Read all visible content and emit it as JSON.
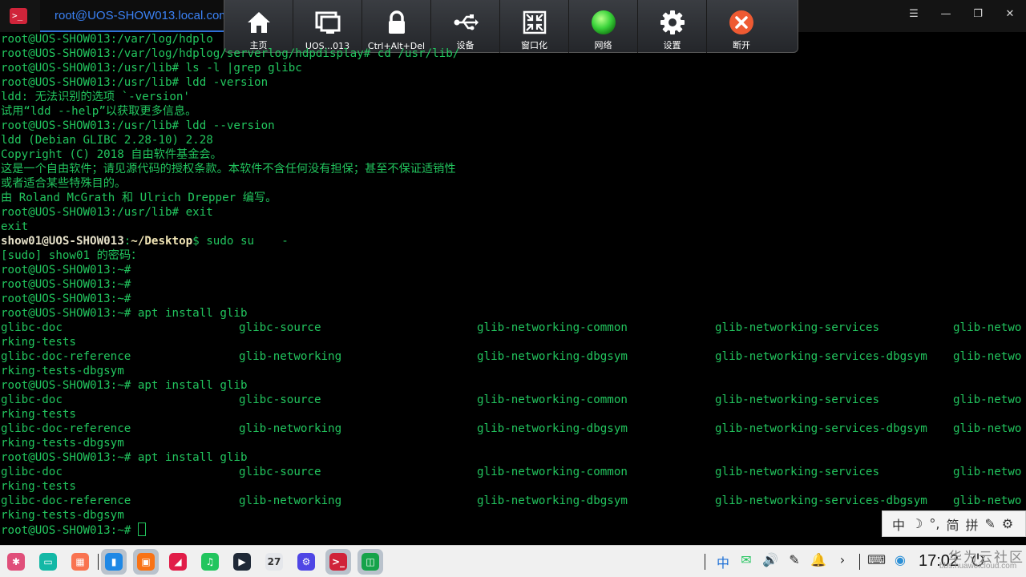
{
  "window": {
    "tab_title": "root@UOS-SHOW013.local.com",
    "term_glyph": ">_",
    "controls": {
      "menu": "☰",
      "minimize": "—",
      "restore": "❐",
      "close": "✕"
    }
  },
  "remote_toolbar": {
    "buttons": [
      {
        "label": "主页",
        "icon": "home-icon"
      },
      {
        "label": "UOS...013",
        "icon": "monitor-icon"
      },
      {
        "label": "Ctrl+Alt+Del",
        "icon": "lock-icon"
      },
      {
        "label": "设备",
        "icon": "usb-icon"
      },
      {
        "label": "窗口化",
        "icon": "windowed-icon"
      },
      {
        "label": "网络",
        "icon": "network-status-icon",
        "color": "#3bd43b"
      },
      {
        "label": "设置",
        "icon": "gear-icon"
      },
      {
        "label": "断开",
        "icon": "disconnect-icon",
        "color": "#ee5a32"
      }
    ]
  },
  "terminal": {
    "lines": [
      "root@UOS-SHOW013:/var/log/hdplo",
      "root@UOS-SHOW013:/var/log/hdplog/serverlog/hdpdisplay# cd /usr/lib/",
      "root@UOS-SHOW013:/usr/lib# ls -l |grep glibc",
      "root@UOS-SHOW013:/usr/lib# ldd -version",
      "ldd: 无法识别的选项 `-version'",
      "试用“ldd --help”以获取更多信息。",
      "root@UOS-SHOW013:/usr/lib# ldd --version",
      "ldd (Debian GLIBC 2.28-10) 2.28",
      "Copyright (C) 2018 自由软件基金会。",
      "这是一个自由软件；请见源代码的授权条款。本软件不含任何没有担保；甚至不保证适销性",
      "或者适合某些特殊目的。",
      "由 Roland McGrath 和 Ulrich Drepper 编写。",
      "root@UOS-SHOW013:/usr/lib# exit",
      "exit"
    ],
    "sudo_line": {
      "user": "show01@UOS-SHOW013",
      "colon": ":",
      "path": "~/Desktop",
      "rest": "$ sudo su    -"
    },
    "password_prompt": "[sudo] show01 的密码：",
    "empty_prompts": [
      "root@UOS-SHOW013:~#",
      "root@UOS-SHOW013:~#",
      "root@UOS-SHOW013:~#"
    ],
    "completion_blocks": [
      {
        "command": "root@UOS-SHOW013:~# apt install glib"
      },
      {
        "command": "root@UOS-SHOW013:~# apt install glib"
      },
      {
        "command": "root@UOS-SHOW013:~# apt install glib"
      }
    ],
    "completion_rows": [
      [
        "glibc-doc",
        "glibc-source",
        "glib-networking-common",
        "glib-networking-services",
        "glib-netwo"
      ],
      [
        "rking-tests"
      ],
      [
        "glibc-doc-reference",
        "glib-networking",
        "glib-networking-dbgsym",
        "glib-networking-services-dbgsym",
        "glib-netwo"
      ],
      [
        "rking-tests-dbgsym"
      ]
    ],
    "final_prompt": "root@UOS-SHOW013:~# "
  },
  "ime_bar": {
    "items": [
      "中",
      "☽",
      "°,",
      "简",
      "拼",
      "✎",
      "⚙"
    ]
  },
  "taskbar": {
    "apps": [
      {
        "name": "launcher-icon",
        "glyph": "✱",
        "color": "#e04f7a"
      },
      {
        "name": "multitask-icon",
        "glyph": "▭",
        "color": "#14b8a6"
      },
      {
        "name": "app-store-grid-icon",
        "glyph": "▦",
        "color": "#f97350"
      },
      {
        "name": "file-manager-icon",
        "glyph": "▮",
        "color": "#1e88e5",
        "active": true
      },
      {
        "name": "app-store-icon",
        "glyph": "▣",
        "color": "#f97316",
        "active": true
      },
      {
        "name": "photos-icon",
        "glyph": "◢",
        "color": "#e11d48"
      },
      {
        "name": "music-icon",
        "glyph": "♫",
        "color": "#22c55e"
      },
      {
        "name": "video-icon",
        "glyph": "▶",
        "color": "#1f2937"
      },
      {
        "name": "calendar-icon",
        "glyph": "27",
        "color": "#e5e7eb",
        "fg": "#333"
      },
      {
        "name": "settings-app-icon",
        "glyph": "⚙",
        "color": "#4f46e5"
      },
      {
        "name": "terminal-app-icon",
        "glyph": ">_",
        "color": "#d0243a",
        "active": true
      },
      {
        "name": "remote-app-icon",
        "glyph": "◫",
        "color": "#16a34a",
        "active": true
      }
    ],
    "tray": [
      {
        "name": "input-method-tray-icon",
        "glyph": "中",
        "color": "#1d6fd6"
      },
      {
        "name": "wechat-tray-icon",
        "glyph": "✉",
        "color": "#22c55e"
      },
      {
        "name": "volume-icon",
        "glyph": "🔊",
        "color": "#222"
      },
      {
        "name": "pen-tray-icon",
        "glyph": "✎",
        "color": "#222"
      },
      {
        "name": "notification-bell-icon",
        "glyph": "🔔",
        "color": "#222"
      },
      {
        "name": "expand-tray-icon",
        "glyph": "›",
        "color": "#222"
      }
    ],
    "tray2": [
      {
        "name": "keyboard-tray-icon",
        "glyph": "⌨",
        "color": "#444"
      },
      {
        "name": "network-tray-icon",
        "glyph": "◉",
        "color": "#2b8fd6"
      }
    ],
    "clock": "17:02",
    "power": "⏻"
  },
  "watermark": {
    "title": "华为云社区",
    "url": "bbs.huaweicloud.com"
  }
}
